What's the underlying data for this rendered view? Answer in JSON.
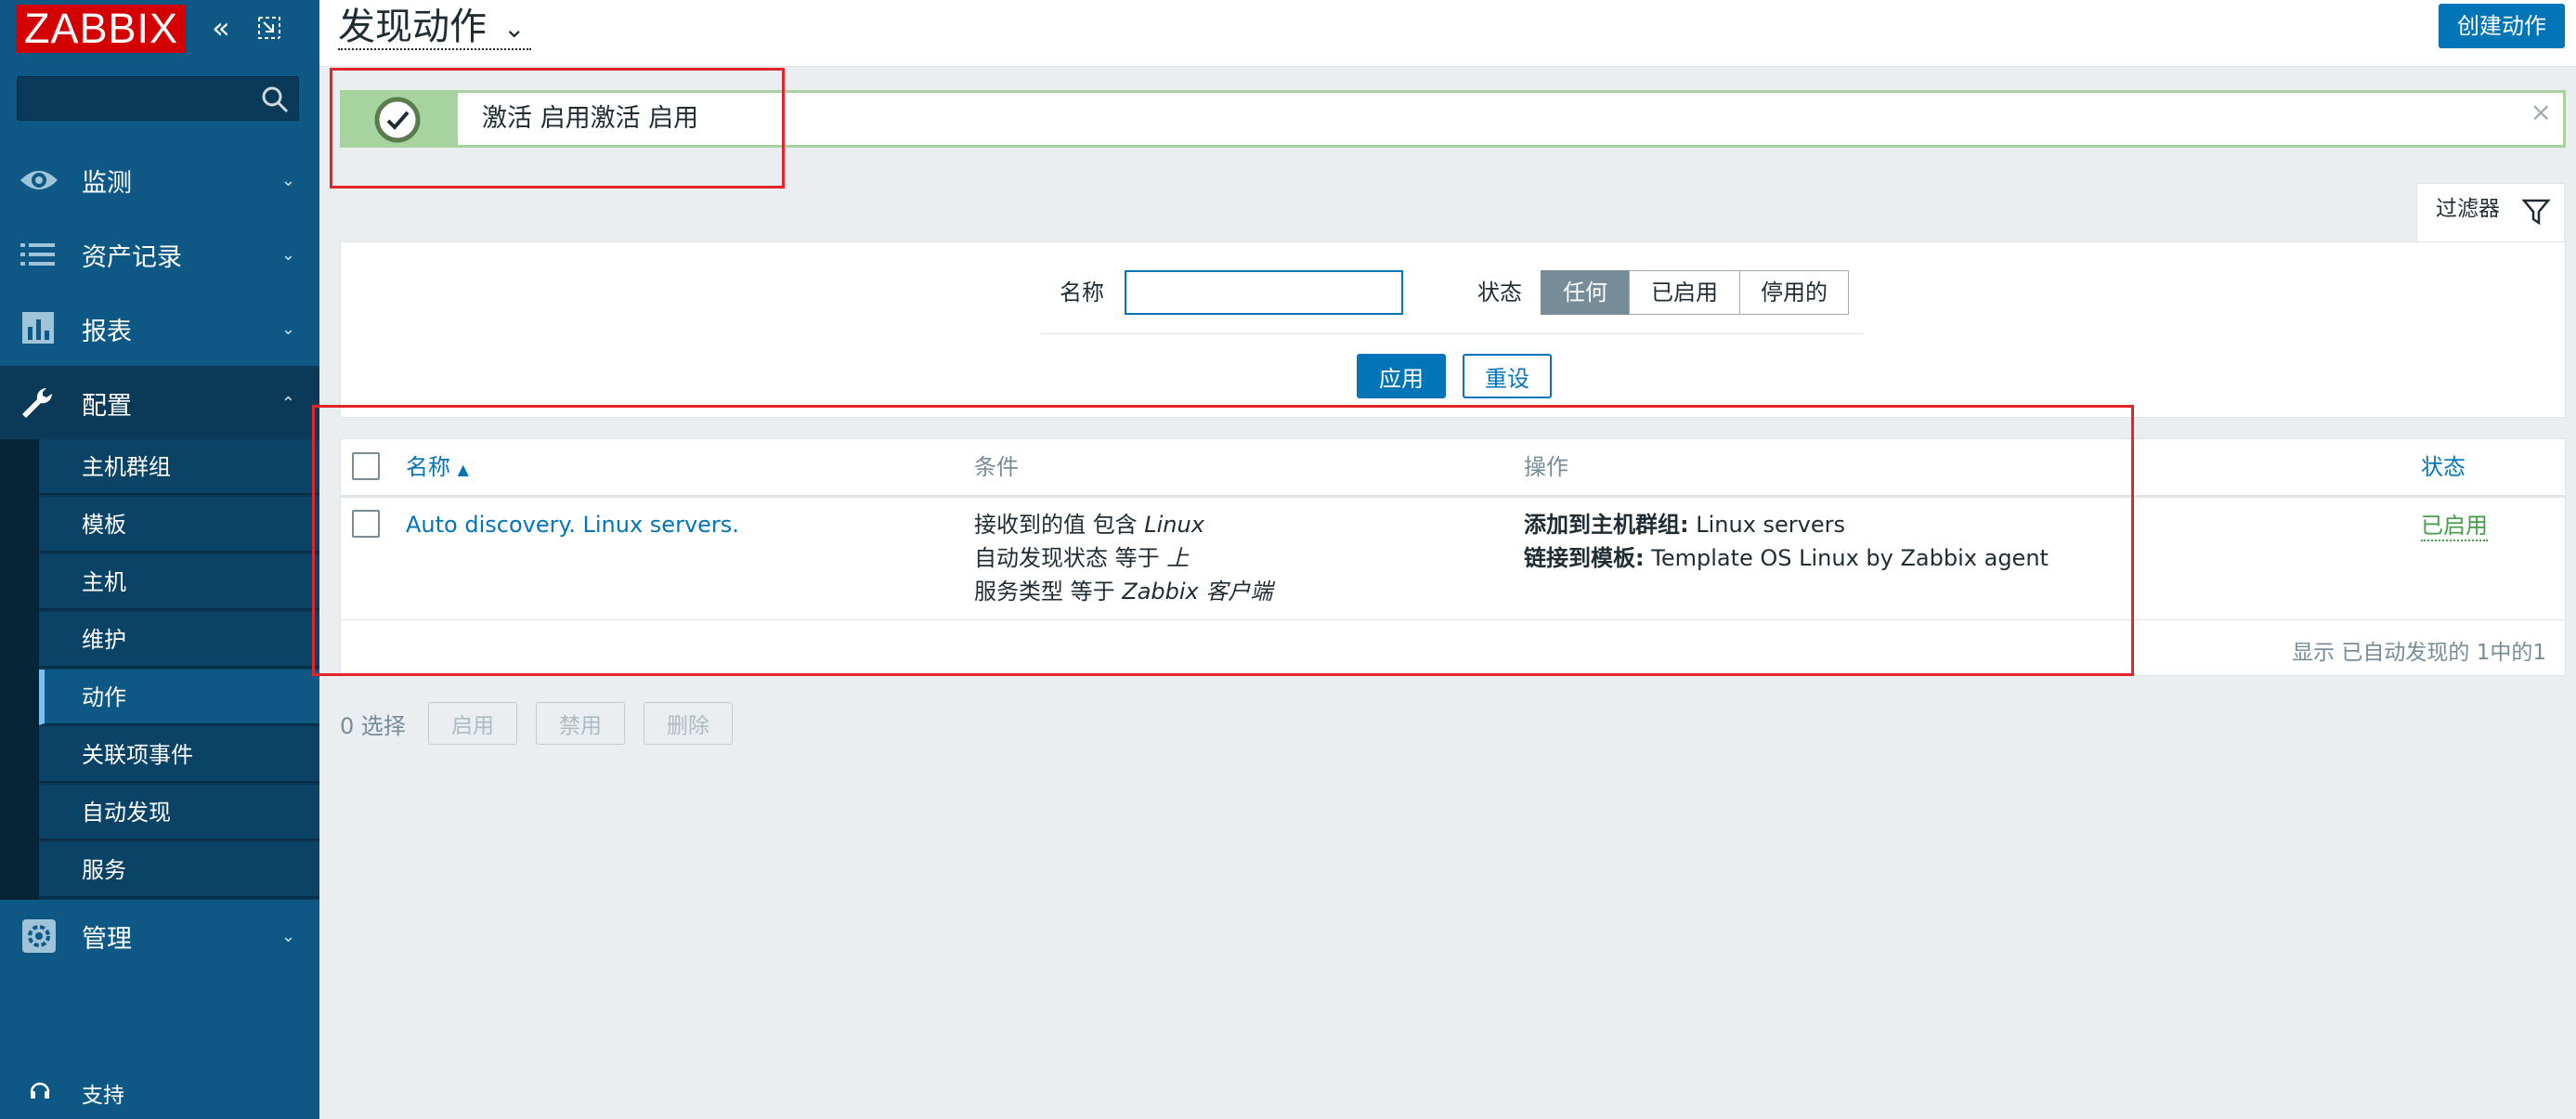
{
  "brand": {
    "logo_text": "ZABBIX"
  },
  "sidebar": {
    "search_placeholder": "",
    "menu": [
      {
        "label": "监测",
        "icon": "eye-icon"
      },
      {
        "label": "资产记录",
        "icon": "list-icon"
      },
      {
        "label": "报表",
        "icon": "bar-chart-icon"
      },
      {
        "label": "配置",
        "icon": "wrench-icon"
      },
      {
        "label": "管理",
        "icon": "gear-icon"
      }
    ],
    "config_submenu": [
      "主机群组",
      "模板",
      "主机",
      "维护",
      "动作",
      "关联项事件",
      "自动发现",
      "服务"
    ],
    "support_label": "支持"
  },
  "header": {
    "title": "发现动作",
    "create_button": "创建动作"
  },
  "message": {
    "text": "激活 启用激活 启用",
    "close_symbol": "×"
  },
  "filter": {
    "tab_label": "过滤器",
    "name_label": "名称",
    "name_value": "",
    "status_label": "状态",
    "status_options": [
      "任何",
      "已启用",
      "停用的"
    ],
    "status_selected": "任何",
    "apply_button": "应用",
    "reset_button": "重设"
  },
  "table": {
    "columns": {
      "name": "名称",
      "sort_arrow": "▲",
      "conditions": "条件",
      "operations": "操作",
      "status": "状态"
    },
    "rows": [
      {
        "name": "Auto discovery. Linux servers.",
        "conditions": [
          {
            "text": "接收到的值 包含 ",
            "value": "Linux"
          },
          {
            "text": "自动发现状态 等于 ",
            "value": "上"
          },
          {
            "text": "服务类型 等于 ",
            "value": "Zabbix 客户端"
          }
        ],
        "operations": [
          {
            "label": "添加到主机群组:",
            "value": " Linux servers"
          },
          {
            "label": "链接到模板:",
            "value": " Template OS Linux by Zabbix agent"
          }
        ],
        "status": "已启用"
      }
    ],
    "footer": "显示 已自动发现的 1中的1"
  },
  "mass_actions": {
    "selected_count": "0 选择",
    "buttons": [
      "启用",
      "禁用",
      "删除"
    ]
  },
  "colors": {
    "sidebar_bg": "#0e5885",
    "accent": "#0275b8",
    "success": "#429e47",
    "logo_red": "#d40000",
    "annotation_red": "#e3242b"
  }
}
